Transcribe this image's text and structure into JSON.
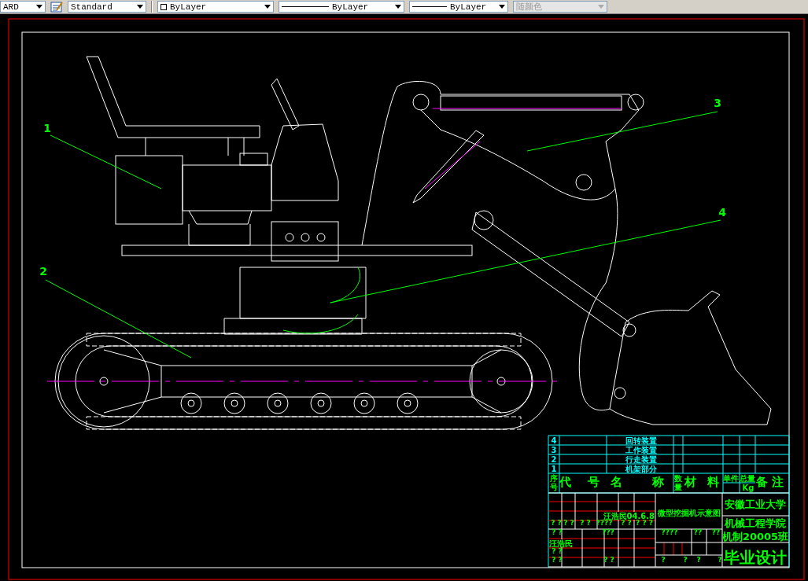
{
  "toolbar": {
    "dropdowns": [
      {
        "kind": "text",
        "value": "ARD",
        "disabled": false
      },
      {
        "kind": "style",
        "value": "Standard",
        "disabled": false
      },
      {
        "kind": "color",
        "value": "ByLayer",
        "disabled": false
      },
      {
        "kind": "linetype",
        "value": "ByLayer",
        "disabled": false
      },
      {
        "kind": "lineweight",
        "value": "ByLayer",
        "disabled": false
      },
      {
        "kind": "plotstyle",
        "value": "随颜色",
        "disabled": true
      }
    ]
  },
  "drawing": {
    "part_labels": [
      "1",
      "2",
      "3",
      "4"
    ],
    "parts_list": [
      {
        "no": "4",
        "name": "回转装置"
      },
      {
        "no": "3",
        "name": "工作装置"
      },
      {
        "no": "2",
        "name": "行走装置"
      },
      {
        "no": "1",
        "name": "机架部分"
      }
    ],
    "header": [
      "序号",
      "代",
      "号",
      "名",
      "称",
      "数量",
      "材",
      "料",
      "单件",
      "总量",
      "Kg",
      "备",
      "注"
    ],
    "marks": [
      "? ?",
      "? ?",
      "? ?",
      "????",
      "? ?",
      "? ? ?",
      "? ?",
      "???",
      "????",
      "??",
      "??",
      "? ?",
      "? ?",
      "? ?",
      "?",
      "?",
      "?",
      "?"
    ],
    "signature_date": "汪浩民04.6.8",
    "signature": "汪浩民",
    "drawing_title": "微型挖掘机示意图",
    "school": "安徽工业大学",
    "college": "机械工程学院",
    "class": "机制20005班",
    "thesis": "毕业设计"
  }
}
